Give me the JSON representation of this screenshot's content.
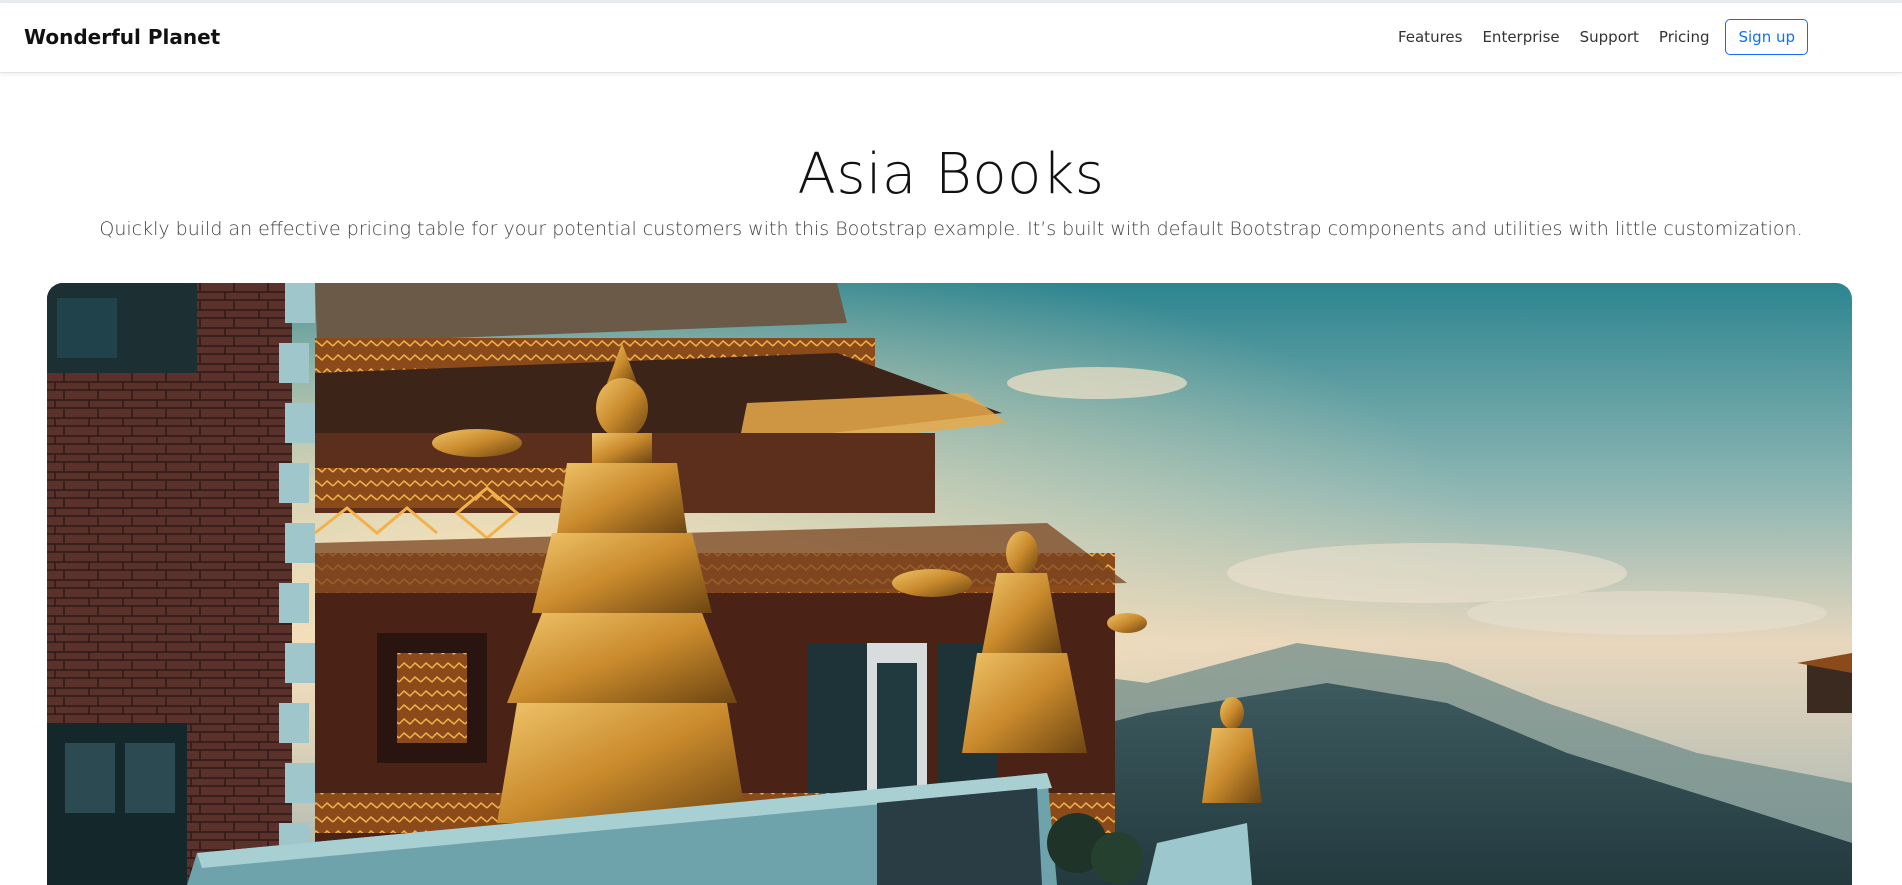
{
  "navbar": {
    "brand": "Wonderful Planet",
    "links": [
      "Features",
      "Enterprise",
      "Support",
      "Pricing"
    ],
    "signup_label": "Sign up"
  },
  "hero": {
    "title": "Asia Books",
    "lead": "Quickly build an effective pricing table for your potential customers with this Bootstrap example. It’s built with default Bootstrap components and utilities with little customization."
  },
  "colors": {
    "accent": "#0d6efd",
    "sky_top": "#2f8a94",
    "sky_glow": "#f3d9b0",
    "temple_gold": "#c98a2c"
  }
}
